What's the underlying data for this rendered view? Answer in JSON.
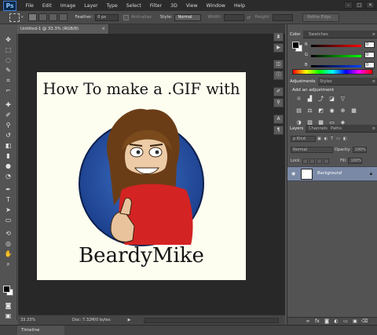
{
  "app": {
    "logo": "Ps"
  },
  "menu": [
    "File",
    "Edit",
    "Image",
    "Layer",
    "Type",
    "Select",
    "Filter",
    "3D",
    "View",
    "Window",
    "Help"
  ],
  "window_controls": [
    "–",
    "□",
    "✕"
  ],
  "options_bar": {
    "feather_label": "Feather:",
    "feather_value": "0 px",
    "anti_alias_label": "Anti-alias",
    "style_label": "Style:",
    "style_value": "Normal",
    "width_label": "Width:",
    "height_label": "Height:",
    "refine_edge": "Refine Edge..."
  },
  "document": {
    "tab_title": "Untitled-1 @ 33.3% (RGB/8)",
    "tab_close": "×",
    "canvas_title": "How To make a .GIF with",
    "canvas_name": "BeardyMike"
  },
  "status": {
    "zoom": "33.33%",
    "doc_info": "Doc: 7.32M/0 bytes",
    "arrow": "▶"
  },
  "timeline": {
    "label": "Timeline"
  },
  "panels": {
    "color": {
      "tabs": [
        "Color",
        "Swatches"
      ],
      "sliders": [
        {
          "label": "R",
          "value": "0",
          "color": "#e03030"
        },
        {
          "label": "G",
          "value": "0",
          "color": "#30c030"
        },
        {
          "label": "B",
          "value": "0",
          "color": "#3050e0"
        }
      ]
    },
    "adjustments": {
      "tabs": [
        "Adjustments",
        "Styles"
      ],
      "title": "Add an adjustment"
    },
    "layers": {
      "tabs": [
        "Layers",
        "Channels",
        "Paths"
      ],
      "kind_placeholder": "ρ Kind",
      "blend_mode": "Normal",
      "opacity_label": "Opacity:",
      "opacity_value": "100%",
      "lock_label": "Lock:",
      "fill_label": "Fill:",
      "fill_value": "100%",
      "items": [
        {
          "name": "Background",
          "locked": true,
          "visible": true
        }
      ]
    }
  }
}
